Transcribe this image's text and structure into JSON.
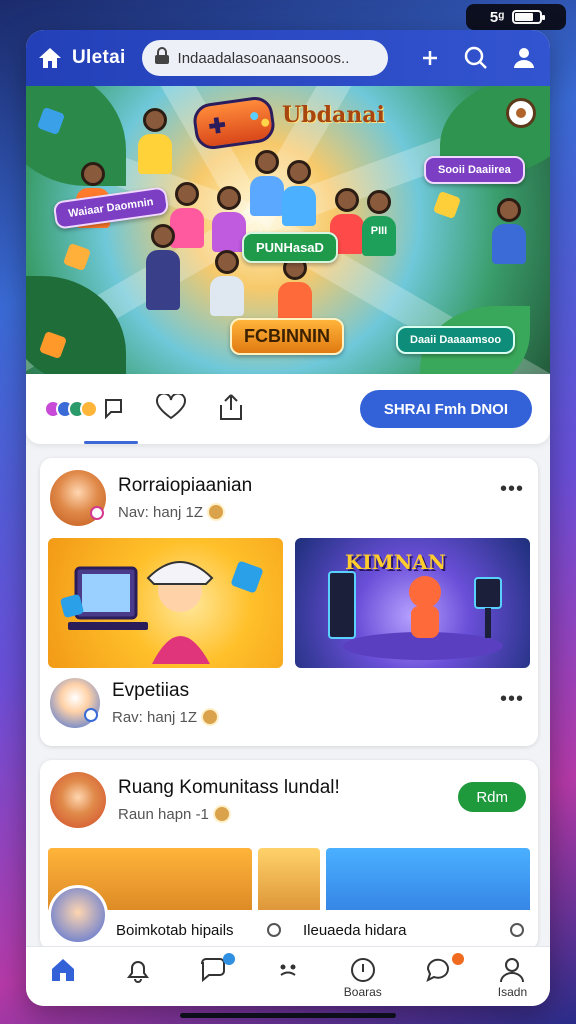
{
  "status_bar": {
    "signal_text": "5ᵍ",
    "battery_level": 0.75
  },
  "top_bar": {
    "brand": "Uletai",
    "url": "Indaadalasoanaansooos..",
    "icons": [
      "home-icon",
      "lock-icon",
      "plus-icon",
      "search-icon",
      "user-icon"
    ]
  },
  "hero": {
    "title_badge": "Ubdanai",
    "tag_left": "Waiaar Daomnin",
    "tag_center": "PUNHasaD",
    "tag_bottom": "FCBINNIN",
    "tag_topright": "Sooii Daaiirea",
    "tag_bottomright": "Daaii Daaaamsoo",
    "jersey_text": "PIII"
  },
  "reaction_bar": {
    "primary_button": "SHRAI Fmh DNOI"
  },
  "post1": {
    "author": "Rorraiopiaanian",
    "meta": "Nav: hanj 1Z",
    "second_author": "Evpetiias",
    "second_meta": "Rav: hanj 1Z",
    "media_right_title": "KIMNAN"
  },
  "post2": {
    "title": "Ruang Komunitass lundal!",
    "meta": "Raun hapn -1",
    "follow_label": "Rdm",
    "strip_left_caption": "Boimkotab hipails",
    "strip_right_caption": "Ileuaeda hidara"
  },
  "bottom_nav": {
    "items": [
      {
        "icon": "home-icon",
        "label": ""
      },
      {
        "icon": "bell-icon",
        "label": ""
      },
      {
        "icon": "chat-icon",
        "label": ""
      },
      {
        "icon": "groups-icon",
        "label": ""
      },
      {
        "icon": "explore-icon",
        "label": "Boaras"
      },
      {
        "icon": "message-icon",
        "label": ""
      },
      {
        "icon": "profile-icon",
        "label": "Isadn"
      }
    ]
  },
  "colors": {
    "accent": "#3361d8",
    "top_bar": "#2340b8",
    "follow": "#1e9a3c",
    "badge_orange": "#f06a20",
    "badge_blue": "#2f8fe0"
  }
}
